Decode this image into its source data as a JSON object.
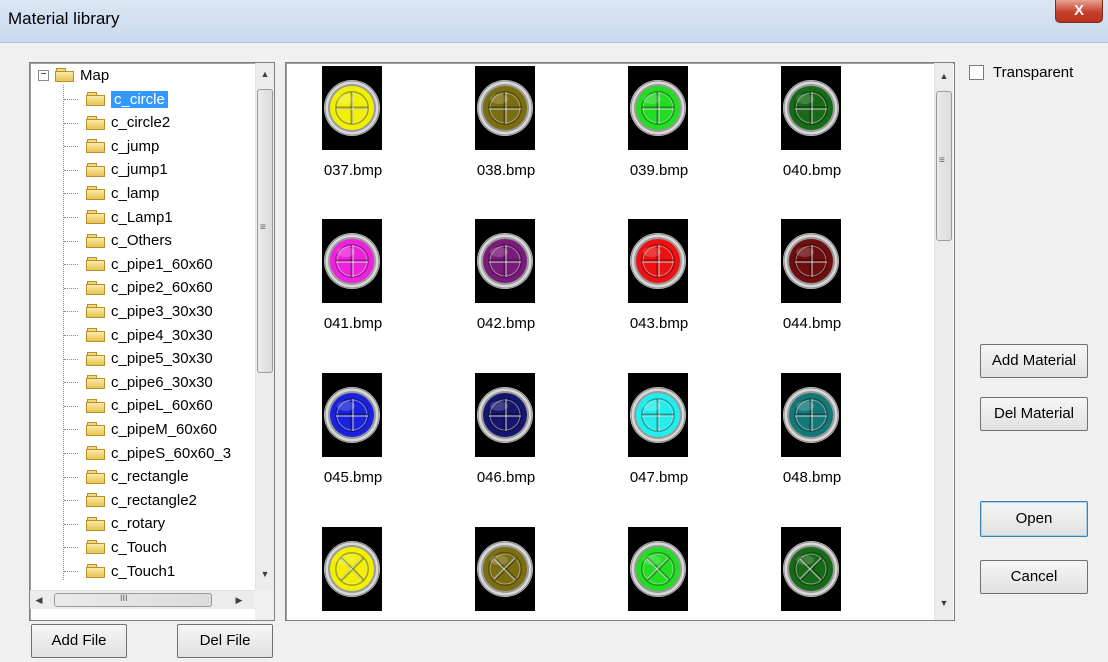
{
  "window": {
    "title": "Material library",
    "close_glyph": "X"
  },
  "tree": {
    "root_label": "Map",
    "expander_glyph": "−",
    "selected_index": 0,
    "items": [
      "c_circle",
      "c_circle2",
      "c_jump",
      "c_jump1",
      "c_lamp",
      "c_Lamp1",
      "c_Others",
      "c_pipe1_60x60",
      "c_pipe2_60x60",
      "c_pipe3_30x30",
      "c_pipe4_30x30",
      "c_pipe5_30x30",
      "c_pipe6_30x30",
      "c_pipeL_60x60",
      "c_pipeM_60x60",
      "c_pipeS_60x60_3",
      "c_rectangle",
      "c_rectangle2",
      "c_rotary",
      "c_Touch",
      "c_Touch1"
    ]
  },
  "gallery": {
    "rows": [
      [
        {
          "name": "037.bmp",
          "color": "#f0f000"
        },
        {
          "name": "038.bmp",
          "color": "#7a6e10"
        },
        {
          "name": "039.bmp",
          "color": "#22dd22"
        },
        {
          "name": "040.bmp",
          "color": "#176a17"
        }
      ],
      [
        {
          "name": "041.bmp",
          "color": "#ee22dd"
        },
        {
          "name": "042.bmp",
          "color": "#7a1a7a"
        },
        {
          "name": "043.bmp",
          "color": "#ee1111"
        },
        {
          "name": "044.bmp",
          "color": "#6e0e0e"
        }
      ],
      [
        {
          "name": "045.bmp",
          "color": "#1a22dd"
        },
        {
          "name": "046.bmp",
          "color": "#16166e"
        },
        {
          "name": "047.bmp",
          "color": "#22eeee"
        },
        {
          "name": "048.bmp",
          "color": "#157878"
        }
      ],
      [
        {
          "name": "",
          "color": "#f0f000",
          "style": "x"
        },
        {
          "name": "",
          "color": "#7a6e10",
          "style": "x"
        },
        {
          "name": "",
          "color": "#22dd22",
          "style": "x"
        },
        {
          "name": "",
          "color": "#176a17",
          "style": "x"
        }
      ]
    ]
  },
  "options": {
    "transparent_label": "Transparent",
    "transparent_checked": false
  },
  "buttons": {
    "add_material": "Add Material",
    "del_material": "Del Material",
    "open": "Open",
    "cancel": "Cancel",
    "add_file": "Add File",
    "del_file": "Del File"
  },
  "scrollbar_glyphs": {
    "up": "▲",
    "down": "▼",
    "left": "◀",
    "right": "▶",
    "grip_v": "≡",
    "grip_h": "III"
  }
}
